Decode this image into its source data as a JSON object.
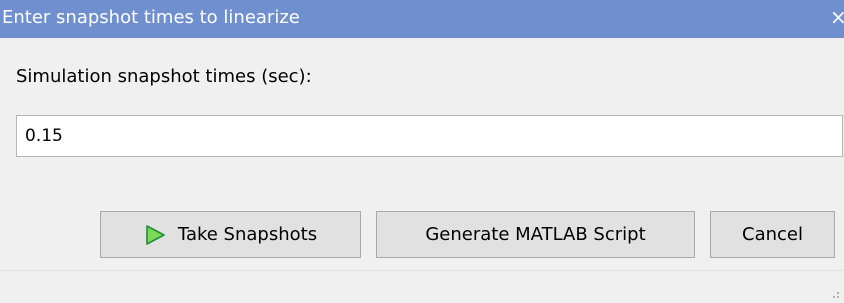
{
  "window": {
    "title": "Enter snapshot times to linearize",
    "close_glyph": "×"
  },
  "form": {
    "label": "Simulation snapshot times (sec):",
    "input_value": "0.15"
  },
  "buttons": {
    "take_snapshots": "Take Snapshots",
    "take_snapshots_icon": "play-icon",
    "generate_script": "Generate MATLAB Script",
    "cancel": "Cancel"
  },
  "colors": {
    "titlebar": "#6f8fcf",
    "play_icon": "#22b34a"
  }
}
